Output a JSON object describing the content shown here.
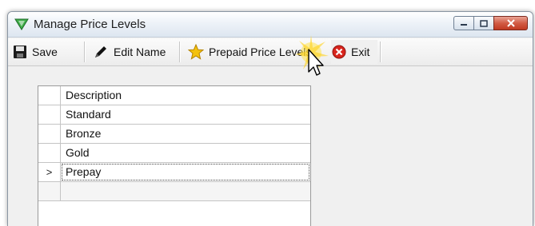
{
  "window": {
    "title": "Manage Price Levels"
  },
  "toolbar": {
    "save_label": "Save",
    "edit_name_label": "Edit Name",
    "prepaid_label": "Prepaid Price Levels",
    "exit_label": "Exit"
  },
  "grid": {
    "header": "Description",
    "rows": [
      {
        "marker": "",
        "value": "Standard"
      },
      {
        "marker": "",
        "value": "Bronze"
      },
      {
        "marker": "",
        "value": "Gold"
      },
      {
        "marker": ">",
        "value": "Prepay"
      }
    ]
  },
  "icons": {
    "app": "green-triangle-app-icon",
    "save": "floppy-disk-icon",
    "edit": "pen-icon",
    "prepaid": "star-icon",
    "exit": "red-x-icon",
    "cursor": "mouse-pointer-icon"
  },
  "colors": {
    "close_button": "#c03a22",
    "star": "#f4c20d",
    "exit": "#d8251d"
  }
}
